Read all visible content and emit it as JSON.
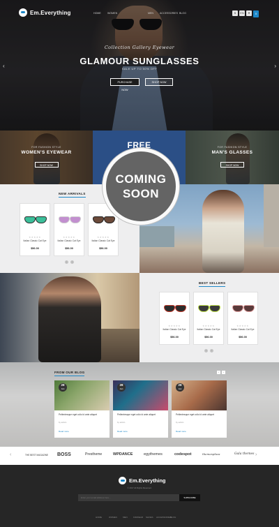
{
  "header": {
    "logo_text": "Em.Everything",
    "nav": [
      "Home",
      "Women",
      "Men",
      "Accessories",
      "Blog"
    ],
    "tools": [
      "$",
      "EN",
      "♥"
    ],
    "cart_count": "0"
  },
  "hero": {
    "subtitle": "Collection Gallery Eyewear",
    "title": "GLAMOUR SUNGLASSES",
    "sale": "SALE UP TO 50% OFF",
    "btn_primary": "Purchase now",
    "btn_secondary": "Shop now",
    "arrow_left": "‹",
    "arrow_right": "›"
  },
  "banners": {
    "left_pre": "For fashion style",
    "left_title": "WOMEN'S EYEWEAR",
    "left_btn": "Shop now",
    "mid_title": "FREE",
    "right_pre": "For fashion style",
    "right_title": "MAN'S GLASSES",
    "right_btn": "Shop now"
  },
  "coming_soon": {
    "line1": "COMING",
    "line2": "SOON"
  },
  "new_arrivals": {
    "title": "NEW ARRIVALS",
    "products": [
      {
        "name": "Italian Classic Cat Eye",
        "price": "$56.00",
        "stars": "★★★★★",
        "frame": "#2a2a2a",
        "lens": "#3cbf9a"
      },
      {
        "name": "Italian Classic Cat Eye",
        "price": "$56.00",
        "stars": "★★★★★",
        "frame": "#cfcfcf",
        "lens": "#c28fcf"
      },
      {
        "name": "Italian Classic Cat Eye",
        "price": "$56.00",
        "stars": "★★★★★",
        "frame": "#1f1f1f",
        "lens": "#6b4a3a"
      }
    ],
    "pager": [
      "‹",
      "›"
    ]
  },
  "best_sellers": {
    "title": "BEST SELLERS",
    "products": [
      {
        "name": "Italian Classic Cat Eye",
        "price": "$56.00",
        "stars": "★★★★★",
        "frame": "#c0392b",
        "lens": "#2b2b2b"
      },
      {
        "name": "Italian Classic Cat Eye",
        "price": "$56.00",
        "stars": "★★★★★",
        "frame": "#bfe04a",
        "lens": "#3a3a3a"
      },
      {
        "name": "Italian Classic Cat Eye",
        "price": "$56.00",
        "stars": "★★★★★",
        "frame": "#e0a0a0",
        "lens": "#5a3a3a"
      }
    ],
    "pager": [
      "‹",
      "›"
    ]
  },
  "blog": {
    "title": "FROM OUR BLOG",
    "arrows": [
      "‹",
      "›"
    ],
    "posts": [
      {
        "day": "28",
        "month": "Jan",
        "title": "Pellentesque eget odio id ante aliquet",
        "by": "by admin",
        "more": "Read more"
      },
      {
        "day": "28",
        "month": "Jan",
        "title": "Pellentesque eget odio id ante aliquet",
        "by": "by admin",
        "more": "Read more"
      },
      {
        "day": "28",
        "month": "Jan",
        "title": "Pellentesque eget odio id ante aliquet",
        "by": "by admin",
        "more": "Read more"
      }
    ]
  },
  "brands": {
    "arrow_left": "‹",
    "arrow_right": "›",
    "items": [
      "THE BEST MAGAZINE",
      "BOSS",
      "Prestheme",
      "WPDANCE",
      "egythemes",
      "codespot",
      "themesplaza",
      "Gala themes"
    ]
  },
  "footer": {
    "logo_text": "Em.Everything",
    "copyright": "© 2017 All Rights Reserved.",
    "search_placeholder": "Enter your email address here...",
    "subscribe": "Subscribe",
    "nav": [
      "Home",
      "Women",
      "Men",
      "Kidwear",
      "Shoes",
      "Accessories",
      "Blog"
    ]
  }
}
